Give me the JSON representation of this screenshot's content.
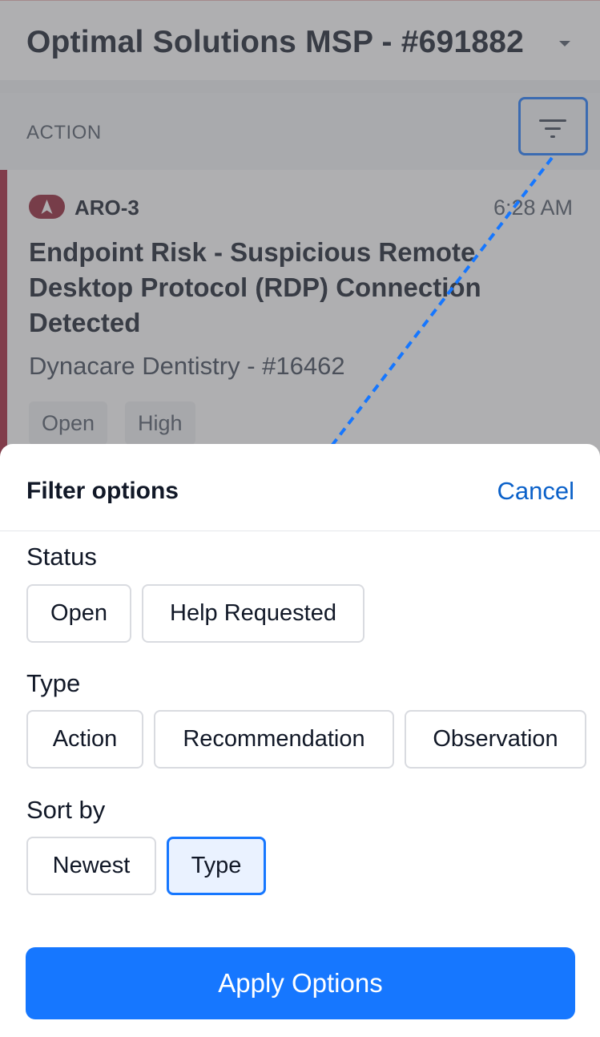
{
  "header": {
    "account_title": "Optimal Solutions MSP - #691882"
  },
  "list": {
    "section_label": "ACTION",
    "card": {
      "id": "ARO-3",
      "time": "6:28 AM",
      "title": "Endpoint Risk - Suspicious Remote Desktop Protocol (RDP) Connection Detected",
      "client": "Dynacare Dentistry - #16462",
      "tags": [
        "Open",
        "High"
      ]
    }
  },
  "filter_sheet": {
    "title": "Filter options",
    "cancel_label": "Cancel",
    "status": {
      "label": "Status",
      "options": [
        "Open",
        "Help Requested"
      ]
    },
    "type": {
      "label": "Type",
      "options": [
        "Action",
        "Recommendation",
        "Observation"
      ]
    },
    "sort": {
      "label": "Sort by",
      "options": [
        "Newest",
        "Type"
      ],
      "selected": "Type"
    },
    "apply_label": "Apply Options"
  },
  "colors": {
    "accent": "#1677ff",
    "link": "#0b61c9",
    "severity": "#a21a33"
  },
  "icons": [
    "filter-icon",
    "aro-arrow-icon",
    "chevron-down-icon"
  ]
}
